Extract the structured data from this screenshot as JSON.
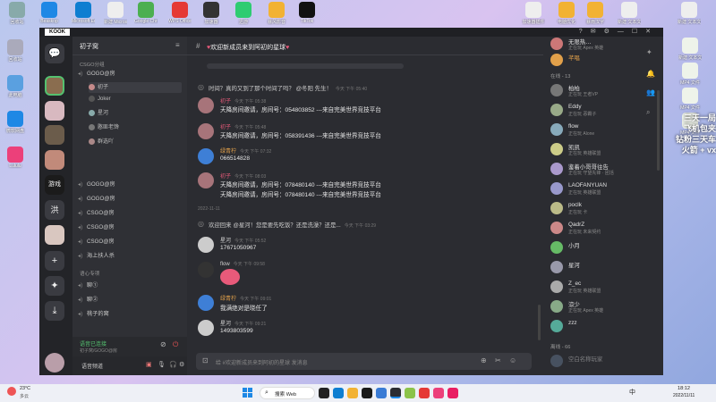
{
  "desktop": {
    "top_icons": [
      "回收站",
      "Beaskop",
      "Microsoft Edge",
      "新建 Microsoft...",
      "Google Chrome",
      "WPS Office",
      "加速器",
      "迅游",
      "暴风影音",
      "TikTok",
      "加速器插件",
      "电脑优化",
      "暴雨汉字",
      "新建 文本文档",
      "新建 文本文档"
    ],
    "left_icons": [
      "回收站",
      "此电脑",
      "微软网盘",
      "Lululu"
    ],
    "right_icons": [
      "新建 文本文档",
      "MP4 文件",
      "MP4 文件",
      "MP4 文件"
    ],
    "overlay_text": [
      "三天一局",
      "飞机包夹",
      "钻粉三天车",
      "火箭 + vx"
    ]
  },
  "app": {
    "logo": "KOOK",
    "server_name": "初子窝",
    "channel_title": "欢迎新成员来到阿初的星球",
    "title_icons": [
      "help-icon",
      "inbox-icon",
      "settings-icon",
      "minimize-icon",
      "maximize-icon",
      "close-icon"
    ]
  },
  "rail": [
    {
      "name": "home",
      "glyph": "☺"
    },
    {
      "name": "server-1",
      "glyph": ""
    },
    {
      "name": "server-2",
      "glyph": ""
    },
    {
      "name": "server-3",
      "glyph": ""
    },
    {
      "name": "server-4",
      "glyph": ""
    },
    {
      "name": "server-5",
      "glyph": "游戏"
    },
    {
      "name": "server-6",
      "glyph": "洪"
    },
    {
      "name": "server-7",
      "glyph": ""
    },
    {
      "name": "add",
      "glyph": "+"
    },
    {
      "name": "discover",
      "glyph": "✦"
    },
    {
      "name": "download",
      "glyph": "⤓"
    }
  ],
  "channels": {
    "group1": "CSGO分组",
    "items": [
      {
        "label": "GOGO@房",
        "type": "voice"
      },
      {
        "label": "GOGO@房",
        "type": "voice"
      },
      {
        "label": "GOGO@房",
        "type": "voice"
      },
      {
        "label": "CSGO@房",
        "type": "voice"
      },
      {
        "label": "CSGO@房",
        "type": "voice"
      },
      {
        "label": "CSGO@房",
        "type": "voice"
      },
      {
        "label": "海上扶人杀",
        "type": "voice"
      }
    ],
    "sub_users": [
      "初子",
      "Joker",
      "星河",
      "憨匪老馋",
      "群选吖"
    ],
    "group2": "语心专项",
    "group2_items": [
      "聊①",
      "聊②",
      "桃子的窝"
    ],
    "voice_status": "语音已连接",
    "voice_detail": "初子窝/GOGO@房",
    "user_name": "语音频道"
  },
  "messages": [
    {
      "kind": "text",
      "text": "时间？真的又到了那个时间了吗？ @冬阳 先生！",
      "time": "今天 下午 05:40"
    },
    {
      "kind": "msg",
      "name": "初子",
      "time": "今天 下午 05:38",
      "lines": [
        "天降房间邀请，房间号：054803852 ---来自完美世界竞技平台"
      ]
    },
    {
      "kind": "msg",
      "name": "初子",
      "time": "今天 下午 05:48",
      "lines": [
        "天降房间邀请，房间号：058391436 ---来自完美世界竞技平台"
      ]
    },
    {
      "kind": "msg",
      "name": "绿青柠",
      "time": "今天 下午 07:32",
      "lines": [
        "066514828"
      ]
    },
    {
      "kind": "msg",
      "name": "初子",
      "time": "今天 下午 08:03",
      "lines": [
        "天降房间邀请，房间号：078480140 ---来自完美世界竞技平台",
        "天降房间邀请，房间号：078480140 ---来自完美世界竞技平台"
      ]
    },
    {
      "kind": "date",
      "text": "2022-11-11"
    },
    {
      "kind": "text",
      "text": "欢迎回来 @星河！您是要先吃饭？还是洗澡？还是...",
      "time": "今天 下午 03:29"
    },
    {
      "kind": "msg",
      "name": "星河",
      "time": "今天 下午 05:52",
      "lines": [
        "17671050967"
      ]
    },
    {
      "kind": "msg",
      "name": "flow",
      "time": "今天 下午 09:58",
      "lines": [
        ""
      ]
    },
    {
      "kind": "msg",
      "name": "绿青柠",
      "time": "今天 下午 09:01",
      "lines": [
        "我满绝对是晓任了"
      ]
    },
    {
      "kind": "msg",
      "name": "星河",
      "time": "今天 下午 09:21",
      "lines": [
        "1493803599"
      ]
    }
  ],
  "composer": {
    "placeholder": "给 #欢迎新成员来到阿初的星球 发消息"
  },
  "members": {
    "top": [
      {
        "name": "无限热…",
        "status": "正在玩 Apex 英雄"
      },
      {
        "name": "芊唱",
        "status": ""
      }
    ],
    "online_header": "在线 - 13",
    "online": [
      {
        "name": "柏柏",
        "status": "正在玩 王者VP"
      },
      {
        "name": "Eddy",
        "status": "正在玩 恶霸子"
      },
      {
        "name": "flow",
        "status": "正在玩 Alone"
      },
      {
        "name": "凯凯",
        "status": "正在玩 英雄联盟"
      },
      {
        "name": "鉴着小哥哥往告",
        "status": "正在玩 守望先锋 · 团活"
      },
      {
        "name": "LAOFANYUAN",
        "status": "正在玩 英雄联盟"
      },
      {
        "name": "poclk",
        "status": "正在玩 卡"
      },
      {
        "name": "QadrZ",
        "status": "正在玩 未来契约"
      },
      {
        "name": "小月",
        "status": ""
      },
      {
        "name": "星河",
        "status": ""
      },
      {
        "name": "Z_ec",
        "status": "正在玩 英雄联盟"
      },
      {
        "name": "涼少",
        "status": "正在玩 Apex 英雄"
      },
      {
        "name": "zzz",
        "status": ""
      }
    ],
    "offline_header": "离线 - 66",
    "offline_first": "空白名称玩家"
  },
  "taskbar": {
    "weather_temp": "23°C",
    "weather_desc": "多云",
    "search_label": "搜索 Web",
    "time": "18:12",
    "date": "2022/11/11",
    "lang": "中"
  },
  "colors": {
    "accent": "#e85a7a",
    "bg": "#2b2c31",
    "green": "#54c16f"
  }
}
